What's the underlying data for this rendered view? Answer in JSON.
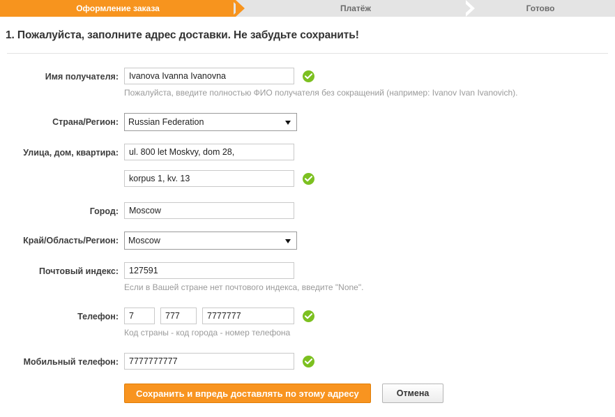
{
  "steps": [
    {
      "label": "Оформление заказа",
      "active": true
    },
    {
      "label": "Платёж",
      "active": false
    },
    {
      "label": "Готово",
      "active": false
    }
  ],
  "page": {
    "title": "1. Пожалуйста, заполните адрес доставки. Не забудьте сохранить!"
  },
  "form": {
    "recipient": {
      "label": "Имя получателя:",
      "value": "Ivanova Ivanna Ivanovna",
      "hint": "Пожалуйста, введите полностью ФИО получателя без сокращений (например: Ivanov Ivan Ivanovich)."
    },
    "country": {
      "label": "Страна/Регион:",
      "value": "Russian Federation"
    },
    "street": {
      "label": "Улица, дом, квартира:",
      "line1": "ul. 800 let Moskvy, dom 28,",
      "line2": "korpus 1, kv. 13"
    },
    "city": {
      "label": "Город:",
      "value": "Moscow"
    },
    "region": {
      "label": "Край/Область/Регион:",
      "value": "Moscow"
    },
    "postcode": {
      "label": "Почтовый индекс:",
      "value": "127591",
      "hint": "Если в Вашей стране нет почтового индекса, введите \"None\"."
    },
    "phone": {
      "label": "Телефон:",
      "country_code": "7",
      "area_code": "777",
      "number": "7777777",
      "hint": "Код страны - код города - номер телефона"
    },
    "mobile": {
      "label": "Мобильный телефон:",
      "value": "7777777777"
    }
  },
  "actions": {
    "save_label": "Сохранить и впредь доставлять по этому адресу",
    "cancel_label": "Отмена"
  },
  "colors": {
    "accent": "#f7941e",
    "valid": "#7cc020",
    "step_inactive": "#e4e4e4"
  }
}
